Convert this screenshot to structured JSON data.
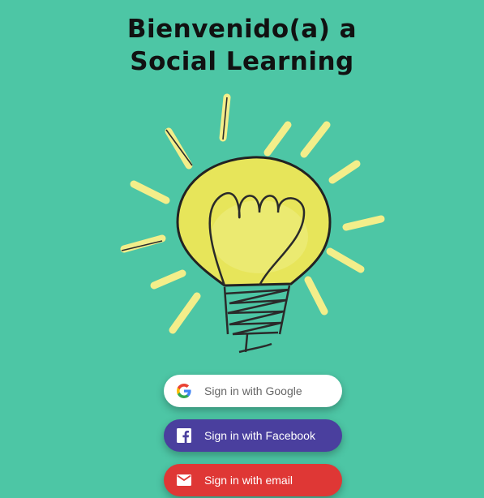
{
  "title": {
    "line1": "Bienvenido(a) a",
    "line2": "Social Learning"
  },
  "buttons": {
    "google": {
      "label": "Sign in with Google",
      "icon": "google-icon"
    },
    "facebook": {
      "label": "Sign in with Facebook",
      "icon": "facebook-icon"
    },
    "email": {
      "label": "Sign in with email",
      "icon": "mail-icon"
    }
  },
  "colors": {
    "background": "#4dc6a5",
    "google_button": "#ffffff",
    "facebook_button": "#4a3f9e",
    "email_button": "#df3735",
    "bulb": "#e7e55a",
    "rays": "#f3ee8a"
  }
}
